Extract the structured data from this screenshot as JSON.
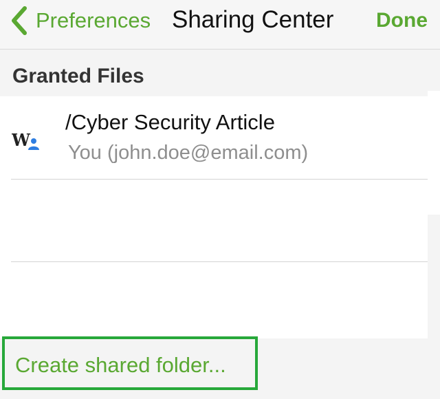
{
  "navbar": {
    "back_label": "Preferences",
    "title": "Sharing Center",
    "done_label": "Done"
  },
  "section": {
    "header": "Granted Files"
  },
  "granted_files": [
    {
      "title": "/Cyber Security Article",
      "subtitle": "You (john.doe@email.com)",
      "icon": "shared-word-document-icon"
    }
  ],
  "footer": {
    "create_label": "Create shared folder..."
  },
  "colors": {
    "accent_green": "#5aa832",
    "highlight_green": "#27a83a",
    "background": "#f4f4f4",
    "list_background": "#ffffff",
    "subtitle_gray": "#8e8e8e",
    "icon_blue": "#2e7de1"
  }
}
